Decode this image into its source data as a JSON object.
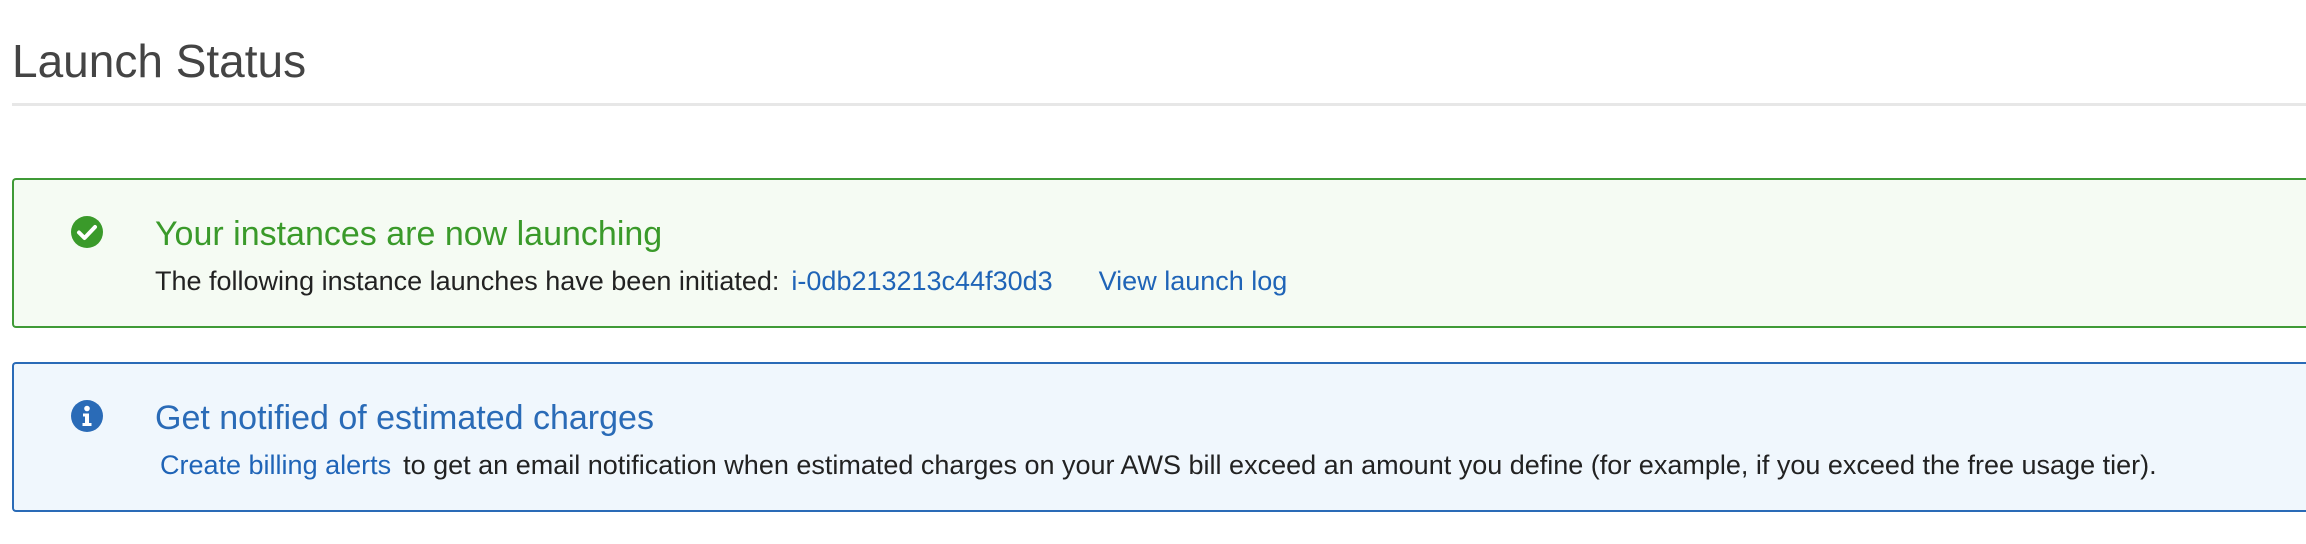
{
  "page": {
    "title": "Launch Status"
  },
  "alerts": {
    "success": {
      "icon": "check-circle-icon",
      "color": "#3a9a2a",
      "title": "Your instances are now launching",
      "body_text": "The following instance launches have been initiated:",
      "instance_id_link": "i-0db213213c44f30d3",
      "view_log_link": "View launch log"
    },
    "info": {
      "icon": "info-circle-icon",
      "color": "#2a6bb7",
      "title": "Get notified of estimated charges",
      "billing_link": "Create billing alerts",
      "body_text": "to get an email notification when estimated charges on your AWS bill exceed an amount you define (for example, if you exceed the free usage tier)."
    }
  }
}
